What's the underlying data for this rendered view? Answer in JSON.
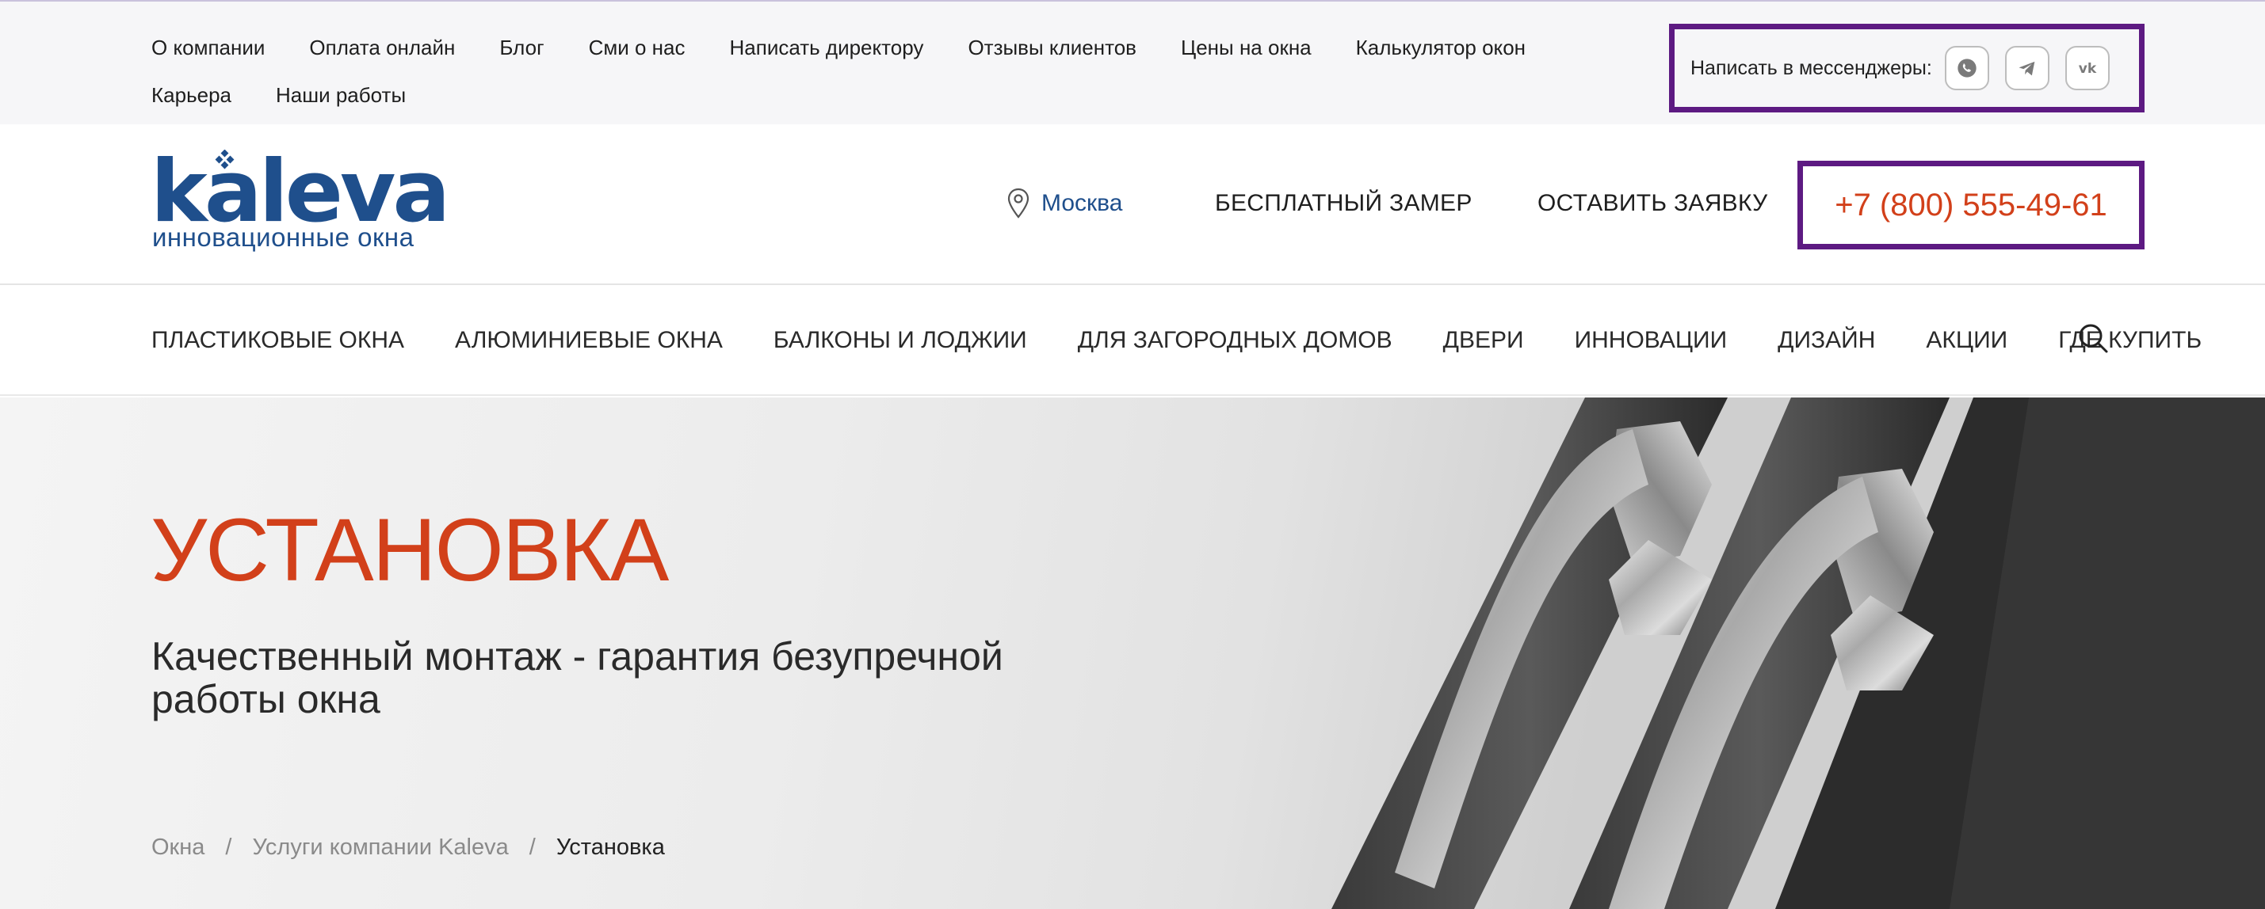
{
  "topbar": {
    "links": [
      "О компании",
      "Оплата онлайн",
      "Блог",
      "Сми о нас",
      "Написать директору",
      "Отзывы клиентов",
      "Цены на окна",
      "Калькулятор окон",
      "Карьера",
      "Наши работы"
    ],
    "messengers_label": "Написать в мессенджеры:",
    "messenger_icons": [
      "whatsapp-icon",
      "telegram-icon",
      "vk-icon"
    ]
  },
  "header": {
    "logo_word": "kaleva",
    "logo_tagline": "инновационные окна",
    "city": "Москва",
    "free_measure": "БЕСПЛАТНЫЙ ЗАМЕР",
    "leave_request": "ОСТАВИТЬ ЗАЯВКУ",
    "phone": "+7 (800) 555-49-61"
  },
  "nav": {
    "items": [
      "ПЛАСТИКОВЫЕ ОКНА",
      "АЛЮМИНИЕВЫЕ ОКНА",
      "БАЛКОНЫ И ЛОДЖИИ",
      "ДЛЯ ЗАГОРОДНЫХ ДОМОВ",
      "ДВЕРИ",
      "ИННОВАЦИИ",
      "ДИЗАЙН",
      "АКЦИИ",
      "ГДЕ КУПИТЬ"
    ],
    "search_icon": "search-icon"
  },
  "hero": {
    "title": "УСТАНОВКА",
    "subtitle": "Качественный монтаж - гарантия безупречной работы окна",
    "breadcrumbs": [
      "Окна",
      "Услуги компании Kaleva",
      "Установка"
    ],
    "separator": "/"
  },
  "colors": {
    "brand_blue": "#1f4f8c",
    "accent_orange": "#d2401a",
    "highlight_purple": "#5d1a82"
  }
}
